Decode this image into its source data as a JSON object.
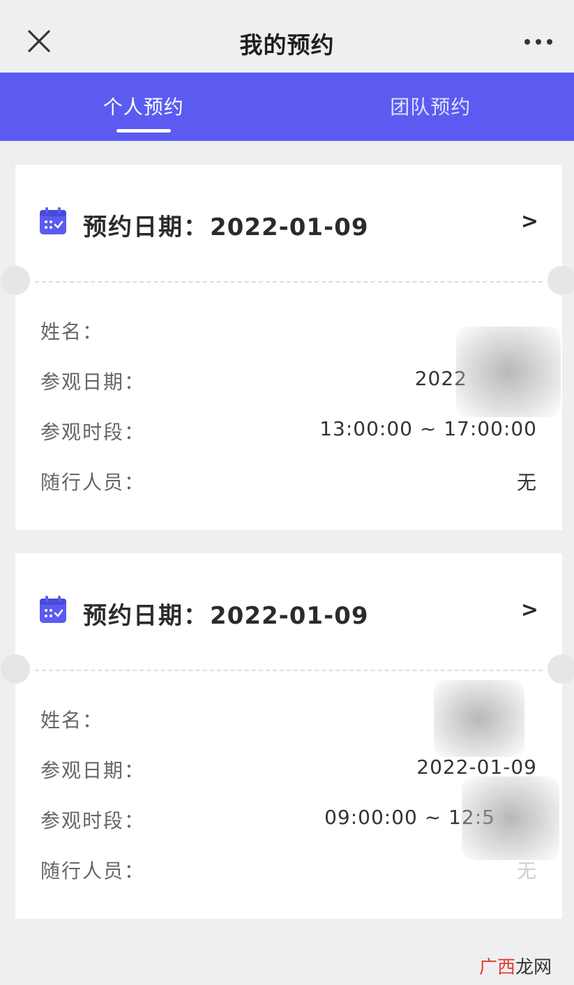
{
  "header": {
    "title": "我的预约"
  },
  "tabs": [
    {
      "label": "个人预约",
      "active": true
    },
    {
      "label": "团队预约",
      "active": false
    }
  ],
  "cards": [
    {
      "date_label": "预约日期：",
      "date": "2022-01-09",
      "arrow": ">",
      "rows": [
        {
          "label": "姓名：",
          "value": ""
        },
        {
          "label": "参观日期：",
          "value": "2022"
        },
        {
          "label": "参观时段：",
          "value": "13:00:00 ~ 17:00:00"
        },
        {
          "label": "随行人员：",
          "value": "无"
        }
      ]
    },
    {
      "date_label": "预约日期：",
      "date": "2022-01-09",
      "arrow": ">",
      "rows": [
        {
          "label": "姓名：",
          "value": ""
        },
        {
          "label": "参观日期：",
          "value": "2022-01-09"
        },
        {
          "label": "参观时段：",
          "value": "09:00:00 ~ 12:5"
        },
        {
          "label": "随行人员：",
          "value": "无"
        }
      ]
    }
  ],
  "watermark": {
    "accent": "广西",
    "rest": "龙网"
  },
  "colors": {
    "tab_bar": "#5b5bf2",
    "icon": "#5b5bf2",
    "background": "#efeff1"
  },
  "icons": [
    "close-icon",
    "more-icon",
    "calendar-icon",
    "chevron-right-icon"
  ]
}
